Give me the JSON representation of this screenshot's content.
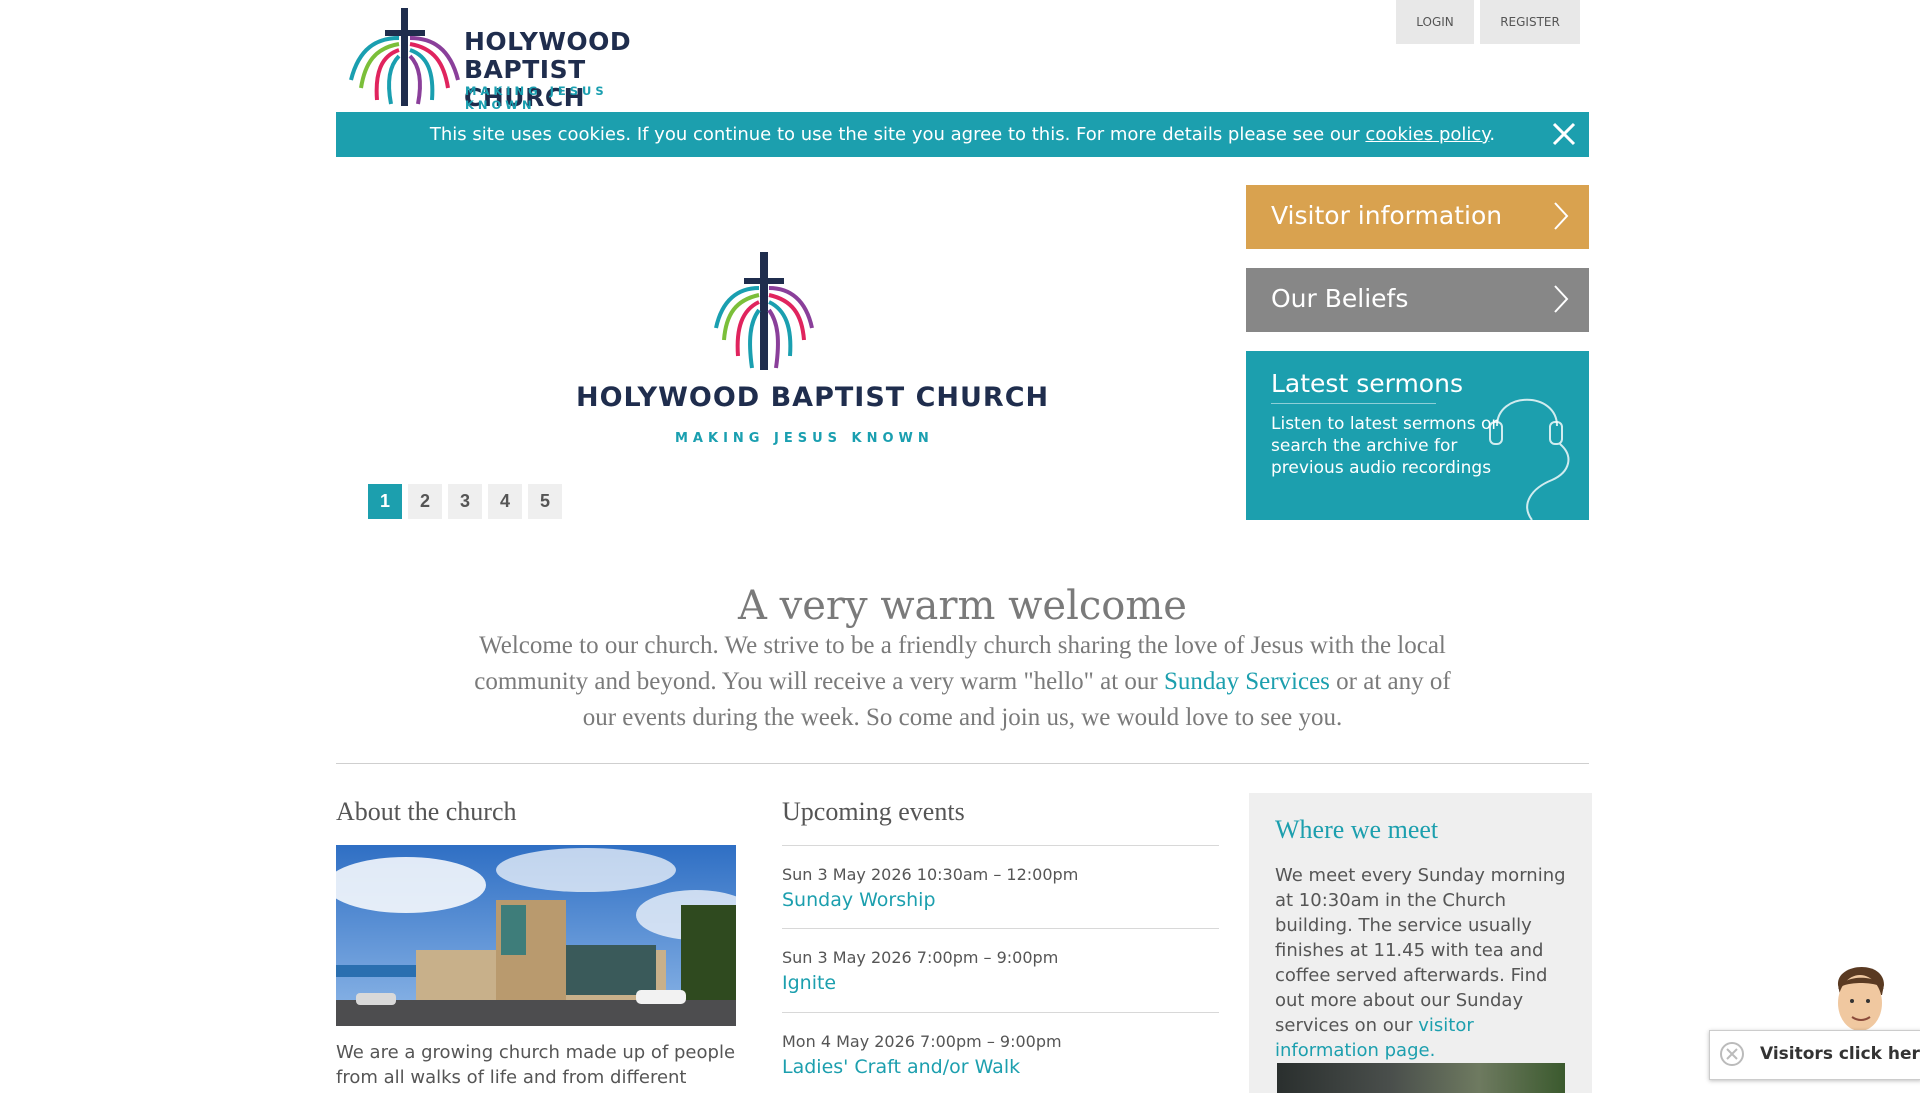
{
  "header": {
    "logo": {
      "line1": "HOLYWOOD",
      "line2": "BAPTIST CHURCH",
      "tagline": "MAKING JESUS KNOWN"
    },
    "login_label": "LOGIN",
    "register_label": "REGISTER"
  },
  "cookie_banner": {
    "text": "This site uses cookies. If you continue to use the site you agree to this. For more details please see our ",
    "link": "cookies policy",
    "end": ".",
    "close_icon": "close-icon"
  },
  "slideshow": {
    "logo_title": "HOLYWOOD BAPTIST CHURCH",
    "logo_tagline": "MAKING JESUS KNOWN",
    "pages": [
      "1",
      "2",
      "3",
      "4",
      "5"
    ],
    "active_page": "1"
  },
  "sidebar": {
    "visitor_label": "Visitor information",
    "beliefs_label": "Our Beliefs",
    "sermons_title": "Latest sermons",
    "sermons_desc": "Listen to latest sermons or search the archive for previous audio recordings",
    "colors": {
      "visitor": "#d9a24f",
      "beliefs": "#878787",
      "sermons": "#1c9fae"
    }
  },
  "welcome": {
    "title": "A very warm welcome",
    "text_before": "Welcome to our church. We strive to be a friendly church sharing the love of Jesus with the local community and beyond. You will receive a very warm \"hello\" at our ",
    "link": "Sunday Services",
    "text_after": " or at any of our events during the week. So come and join us, we would love to see you."
  },
  "about": {
    "title": "About the church",
    "text": "We are a growing church made up of people from all walks of life and from different"
  },
  "events": {
    "title": "Upcoming events",
    "items": [
      {
        "time": "Sun 3 May 2026 10:30am – 12:00pm",
        "name": "Sunday Worship"
      },
      {
        "time": "Sun 3 May 2026 7:00pm – 9:00pm",
        "name": "Ignite"
      },
      {
        "time": "Mon 4 May 2026 7:00pm – 9:00pm",
        "name": "Ladies' Craft and/or Walk"
      }
    ]
  },
  "meet": {
    "title": "Where we meet",
    "text": "We meet every Sunday morning at 10:30am in the Church building. The service usually finishes at 11.45 with tea and coffee served afterwards. Find out more about our Sunday services on our ",
    "link": "visitor information page."
  },
  "visitors_widget": {
    "label": "Visitors click here."
  },
  "theme": {
    "accent": "#1c9fae",
    "brand_navy": "#1f2d4d"
  }
}
